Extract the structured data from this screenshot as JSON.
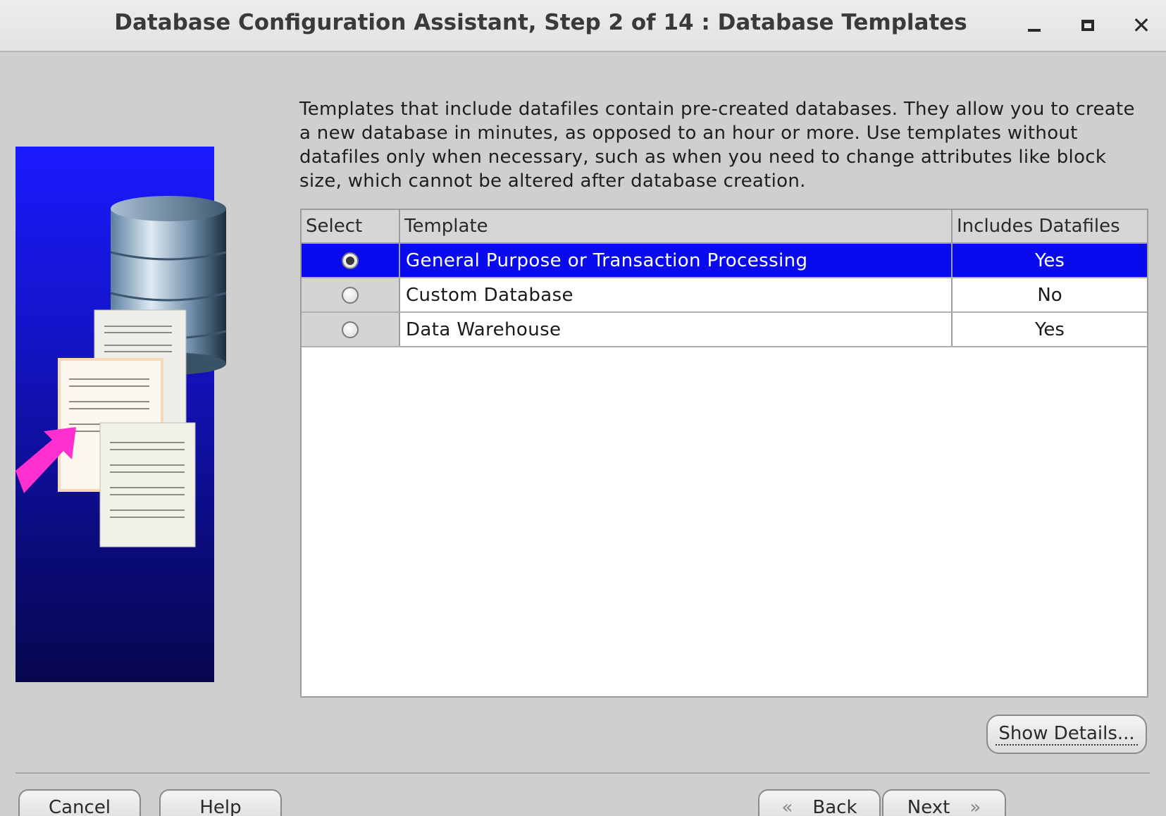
{
  "window": {
    "title": "Database Configuration Assistant, Step 2 of 14 : Database Templates"
  },
  "description": "Templates that include datafiles contain pre-created databases. They allow you to create a new database in minutes, as opposed to an hour or more. Use templates without datafiles only when necessary, such as when you need to change attributes like block size, which cannot be altered after database creation.",
  "table": {
    "headers": [
      "Select",
      "Template",
      "Includes Datafiles"
    ],
    "rows": [
      {
        "template": "General Purpose or Transaction Processing",
        "includes": "Yes"
      },
      {
        "template": "Custom Database",
        "includes": "No"
      },
      {
        "template": "Data Warehouse",
        "includes": "Yes"
      }
    ]
  },
  "buttons": {
    "show_details": "Show Details...",
    "cancel": "Cancel",
    "help": "Help",
    "back": "Back",
    "next": "Next"
  },
  "colors": {
    "selection": "#0a0aee",
    "art_blue": "#1414c8"
  },
  "icons": {
    "minimize": "minimize-icon",
    "maximize": "maximize-icon",
    "close": "close-icon",
    "back": "chevron-left-double-icon",
    "next": "chevron-right-double-icon"
  }
}
